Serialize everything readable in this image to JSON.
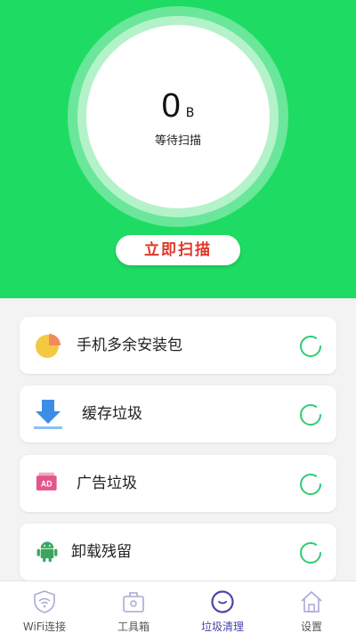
{
  "scan": {
    "size_value": "0",
    "size_unit": "B",
    "status": "等待扫描",
    "button_label": "立即扫描"
  },
  "items": [
    {
      "label": "手机多余安装包",
      "icon": "pie-chart-icon"
    },
    {
      "label": "缓存垃圾",
      "icon": "download-icon"
    },
    {
      "label": "广告垃圾",
      "icon": "ad-icon"
    },
    {
      "label": "卸载残留",
      "icon": "android-icon"
    }
  ],
  "tabs": [
    {
      "label": "WiFi连接",
      "icon": "wifi-shield-icon",
      "active": false
    },
    {
      "label": "工具箱",
      "icon": "toolbox-icon",
      "active": false
    },
    {
      "label": "垃圾清理",
      "icon": "clean-icon",
      "active": true
    },
    {
      "label": "设置",
      "icon": "home-icon",
      "active": false
    }
  ],
  "colors": {
    "hero_green": "#1edc63",
    "accent_red": "#e0372a",
    "tab_active": "#4a45a6",
    "spinner": "#2ecc71"
  }
}
